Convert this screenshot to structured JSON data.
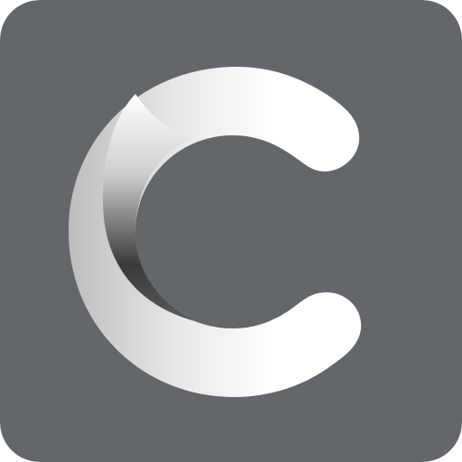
{
  "icon": {
    "name": "c-letter-logo",
    "colors": {
      "tile_background": "#63666b",
      "letter_highlight": "#ffffff",
      "letter_light_gray": "#e6e6e6",
      "letter_mid_gray": "#bdbdbd",
      "letter_shadow": "#3a3a3a"
    }
  }
}
